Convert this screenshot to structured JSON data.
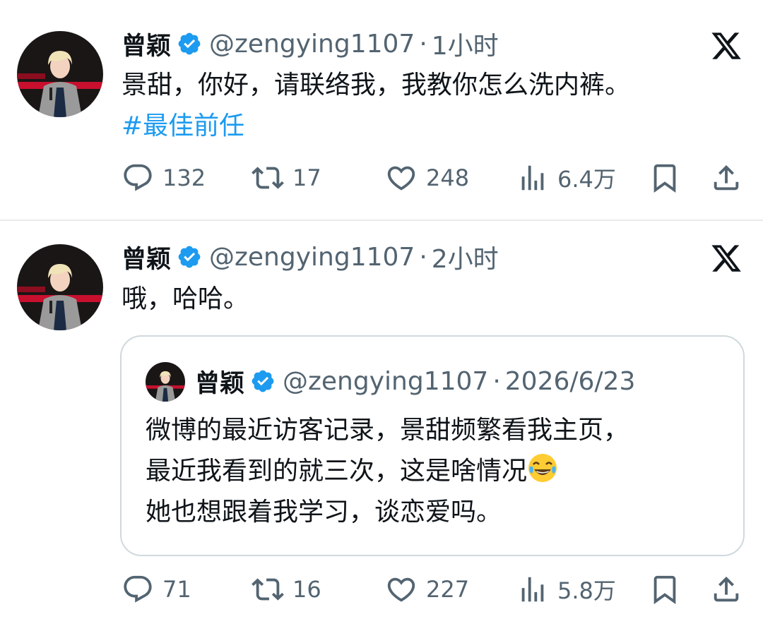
{
  "tweets": [
    {
      "author": {
        "name": "曾颖",
        "handle": "@zengying1107",
        "separator": "·",
        "time": "1小时",
        "verified": true
      },
      "text": "景甜，你好，请联络我，我教你怎么洗内裤。",
      "hashtag": "#最佳前任",
      "stats": {
        "replies": "132",
        "retweets": "17",
        "likes": "248",
        "views": "6.4万"
      }
    },
    {
      "author": {
        "name": "曾颖",
        "handle": "@zengying1107",
        "separator": "·",
        "time": "2小时",
        "verified": true
      },
      "text": "哦，哈哈。",
      "quote": {
        "author": {
          "name": "曾颖",
          "handle": "@zengying1107",
          "separator": "·",
          "date": "2026/6/23"
        },
        "lines": [
          "微博的最近访客记录，景甜频繁看我主页，",
          "最近我看到的就三次，这是啥情况",
          "她也想跟着我学习，谈恋爱吗。"
        ],
        "emoji": "face-with-tears-of-joy-emoji"
      },
      "stats": {
        "replies": "71",
        "retweets": "16",
        "likes": "227",
        "views": "5.8万"
      }
    }
  ],
  "icons": {
    "reply": "reply-icon",
    "retweet": "retweet-icon",
    "like": "heart-icon",
    "views": "views-icon",
    "bookmark": "bookmark-icon",
    "share": "share-icon",
    "platform": "x-logo-icon",
    "verified": "verified-badge-icon"
  },
  "colors": {
    "link": "#1d9bf0",
    "secondary": "#536471",
    "border": "#cfd9de",
    "verified": "#1d9bf0"
  }
}
